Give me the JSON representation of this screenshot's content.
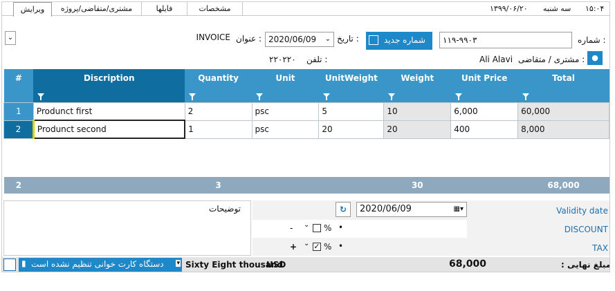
{
  "tabs": [
    "ویرایش",
    "مشتری/متقاضی/پروژه",
    "فایلها",
    "مشخصات"
  ],
  "status_top": {
    "day": "سه شنبه",
    "date": "۱۳۹۹/۰۶/۲۰",
    "time": "۱۵:۰۴"
  },
  "form": {
    "number_label": "شماره :",
    "number_value": "۱۱۹-۹۹۰۳",
    "new_number_button": "شماره جدید",
    "date_label": "تاریخ :",
    "date_value": "2020/06/09",
    "title_label": "عنوان :",
    "title_value": "INVOICE",
    "customer_label": "مشتری / متقاضی :",
    "customer_value": "Ali Alavi",
    "phone_label": "تلفن :",
    "phone_value": "۲۲۰۲۲۰"
  },
  "table": {
    "headers": [
      "#",
      "Discription",
      "Quantity",
      "Unit",
      "UnitWeight",
      "Weight",
      "Unit Price",
      "Total"
    ],
    "rows": [
      [
        "1",
        "Produnct first",
        "2",
        "psc",
        "5",
        "10",
        "6,000",
        "60,000"
      ],
      [
        "2",
        "Produnct second",
        "1",
        "psc",
        "20",
        "20",
        "400",
        "8,000"
      ]
    ],
    "footer": [
      "2",
      "",
      "3",
      "",
      "",
      "30",
      "",
      "68,000"
    ]
  },
  "description_label": "توضیحات",
  "validity": {
    "label": "Validity date",
    "value": "2020/06/09"
  },
  "discount": {
    "label": "DISCOUNT",
    "percent": "%",
    "sign": "-",
    "checked": false
  },
  "tax": {
    "label": "TAX",
    "percent": "%",
    "sign": "+",
    "checked": true
  },
  "bottom": {
    "card_reader_text": "دستگاه کارت خوانی تنظیم نشده است",
    "amount_words": "Sixty Eight thousand",
    "currency": "USD",
    "amount_value": "68,000",
    "final_amount_label": ": مبلغ نهایی"
  }
}
